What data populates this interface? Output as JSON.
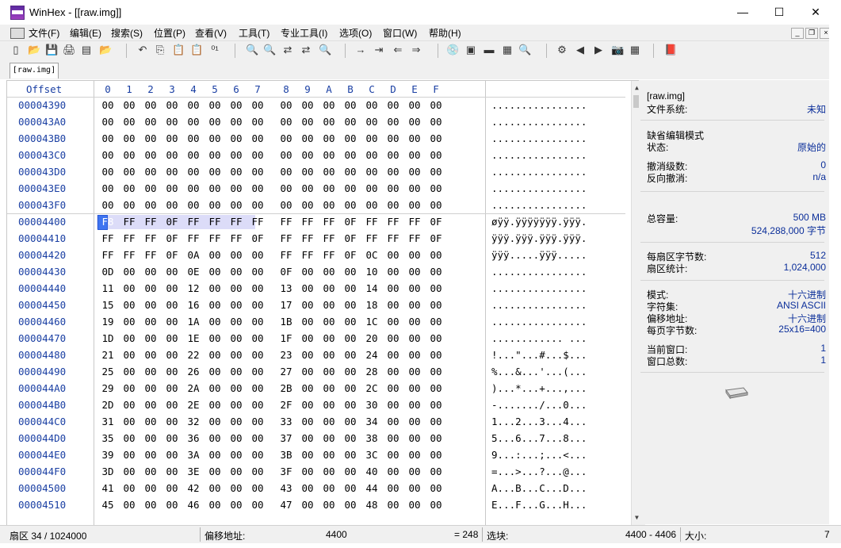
{
  "window": {
    "title": "WinHex - [[raw.img]]",
    "minimize": "—",
    "maximize": "☐",
    "close": "✕"
  },
  "menu": {
    "items": [
      "文件(F)",
      "编辑(E)",
      "搜索(S)",
      "位置(P)",
      "查看(V)",
      "工具(T)",
      "专业工具(I)",
      "选项(O)",
      "窗口(W)",
      "帮助(H)"
    ]
  },
  "mdi": {
    "min": "_",
    "restore": "❐",
    "close": "×"
  },
  "toolbar": {
    "icons": [
      "new-file-icon",
      "open-folder-icon",
      "save-icon",
      "print-icon",
      "properties-icon",
      "open-folder-2-icon",
      "undo-icon",
      "copy-icon",
      "paste-icon",
      "clipboard-icon",
      "hex-write-icon",
      "find-icon",
      "find-hex-icon",
      "replace-icon",
      "replace-hex-icon",
      "find-next-icon",
      "goto-offset-icon",
      "goto-sector-icon",
      "back-icon",
      "forward-icon",
      "disk-open-icon",
      "disk-clone-icon",
      "ram-icon",
      "calculator-icon",
      "magnifier-icon",
      "analyze-icon",
      "prev-icon",
      "next-icon",
      "snapshot-icon",
      "table-icon",
      "book-icon"
    ],
    "glyphs": [
      "▯",
      "📂",
      "💾",
      "🖨",
      "▤",
      "📂",
      "↶",
      "⎘",
      "📋",
      "📋",
      "⁰¹",
      "🔍",
      "🔍",
      "⇄",
      "⇄",
      "🔍",
      "→",
      "⇥",
      "⇐",
      "⇒",
      "💿",
      "▣",
      "▬",
      "▦",
      "🔍",
      "⚙",
      "◀",
      "▶",
      "📷",
      "▦",
      "📕"
    ]
  },
  "tab": {
    "label": "[raw.img]"
  },
  "editor": {
    "offset_header": "Offset",
    "columns": [
      "0",
      "1",
      "2",
      "3",
      "4",
      "5",
      "6",
      "7",
      "8",
      "9",
      "A",
      "B",
      "C",
      "D",
      "E",
      "F"
    ],
    "rows_top": [
      {
        "offset": "00004390",
        "bytes": [
          "00",
          "00",
          "00",
          "00",
          "00",
          "00",
          "00",
          "00",
          "00",
          "00",
          "00",
          "00",
          "00",
          "00",
          "00",
          "00"
        ],
        "ascii": "................"
      },
      {
        "offset": "000043A0",
        "bytes": [
          "00",
          "00",
          "00",
          "00",
          "00",
          "00",
          "00",
          "00",
          "00",
          "00",
          "00",
          "00",
          "00",
          "00",
          "00",
          "00"
        ],
        "ascii": "................"
      },
      {
        "offset": "000043B0",
        "bytes": [
          "00",
          "00",
          "00",
          "00",
          "00",
          "00",
          "00",
          "00",
          "00",
          "00",
          "00",
          "00",
          "00",
          "00",
          "00",
          "00"
        ],
        "ascii": "................"
      },
      {
        "offset": "000043C0",
        "bytes": [
          "00",
          "00",
          "00",
          "00",
          "00",
          "00",
          "00",
          "00",
          "00",
          "00",
          "00",
          "00",
          "00",
          "00",
          "00",
          "00"
        ],
        "ascii": "................"
      },
      {
        "offset": "000043D0",
        "bytes": [
          "00",
          "00",
          "00",
          "00",
          "00",
          "00",
          "00",
          "00",
          "00",
          "00",
          "00",
          "00",
          "00",
          "00",
          "00",
          "00"
        ],
        "ascii": "................"
      },
      {
        "offset": "000043E0",
        "bytes": [
          "00",
          "00",
          "00",
          "00",
          "00",
          "00",
          "00",
          "00",
          "00",
          "00",
          "00",
          "00",
          "00",
          "00",
          "00",
          "00"
        ],
        "ascii": "................"
      },
      {
        "offset": "000043F0",
        "bytes": [
          "00",
          "00",
          "00",
          "00",
          "00",
          "00",
          "00",
          "00",
          "00",
          "00",
          "00",
          "00",
          "00",
          "00",
          "00",
          "00"
        ],
        "ascii": "................"
      }
    ],
    "rows_bottom": [
      {
        "offset": "00004400",
        "bytes": [
          "F8",
          "FF",
          "FF",
          "0F",
          "FF",
          "FF",
          "FF",
          "FF",
          "FF",
          "FF",
          "FF",
          "0F",
          "FF",
          "FF",
          "FF",
          "0F"
        ],
        "ascii": "øÿÿ.ÿÿÿÿÿÿÿ.ÿÿÿ."
      },
      {
        "offset": "00004410",
        "bytes": [
          "FF",
          "FF",
          "FF",
          "0F",
          "FF",
          "FF",
          "FF",
          "0F",
          "FF",
          "FF",
          "FF",
          "0F",
          "FF",
          "FF",
          "FF",
          "0F"
        ],
        "ascii": "ÿÿÿ.ÿÿÿ.ÿÿÿ.ÿÿÿ."
      },
      {
        "offset": "00004420",
        "bytes": [
          "FF",
          "FF",
          "FF",
          "0F",
          "0A",
          "00",
          "00",
          "00",
          "FF",
          "FF",
          "FF",
          "0F",
          "0C",
          "00",
          "00",
          "00"
        ],
        "ascii": "ÿÿÿ.....ÿÿÿ....."
      },
      {
        "offset": "00004430",
        "bytes": [
          "0D",
          "00",
          "00",
          "00",
          "0E",
          "00",
          "00",
          "00",
          "0F",
          "00",
          "00",
          "00",
          "10",
          "00",
          "00",
          "00"
        ],
        "ascii": "................"
      },
      {
        "offset": "00004440",
        "bytes": [
          "11",
          "00",
          "00",
          "00",
          "12",
          "00",
          "00",
          "00",
          "13",
          "00",
          "00",
          "00",
          "14",
          "00",
          "00",
          "00"
        ],
        "ascii": "................"
      },
      {
        "offset": "00004450",
        "bytes": [
          "15",
          "00",
          "00",
          "00",
          "16",
          "00",
          "00",
          "00",
          "17",
          "00",
          "00",
          "00",
          "18",
          "00",
          "00",
          "00"
        ],
        "ascii": "................"
      },
      {
        "offset": "00004460",
        "bytes": [
          "19",
          "00",
          "00",
          "00",
          "1A",
          "00",
          "00",
          "00",
          "1B",
          "00",
          "00",
          "00",
          "1C",
          "00",
          "00",
          "00"
        ],
        "ascii": "................"
      },
      {
        "offset": "00004470",
        "bytes": [
          "1D",
          "00",
          "00",
          "00",
          "1E",
          "00",
          "00",
          "00",
          "1F",
          "00",
          "00",
          "00",
          "20",
          "00",
          "00",
          "00"
        ],
        "ascii": "............ ..."
      },
      {
        "offset": "00004480",
        "bytes": [
          "21",
          "00",
          "00",
          "00",
          "22",
          "00",
          "00",
          "00",
          "23",
          "00",
          "00",
          "00",
          "24",
          "00",
          "00",
          "00"
        ],
        "ascii": "!...\"...#...$..."
      },
      {
        "offset": "00004490",
        "bytes": [
          "25",
          "00",
          "00",
          "00",
          "26",
          "00",
          "00",
          "00",
          "27",
          "00",
          "00",
          "00",
          "28",
          "00",
          "00",
          "00"
        ],
        "ascii": "%...&...'...(..."
      },
      {
        "offset": "000044A0",
        "bytes": [
          "29",
          "00",
          "00",
          "00",
          "2A",
          "00",
          "00",
          "00",
          "2B",
          "00",
          "00",
          "00",
          "2C",
          "00",
          "00",
          "00"
        ],
        "ascii": ")...*...+...,..."
      },
      {
        "offset": "000044B0",
        "bytes": [
          "2D",
          "00",
          "00",
          "00",
          "2E",
          "00",
          "00",
          "00",
          "2F",
          "00",
          "00",
          "00",
          "30",
          "00",
          "00",
          "00"
        ],
        "ascii": "-......./...0..."
      },
      {
        "offset": "000044C0",
        "bytes": [
          "31",
          "00",
          "00",
          "00",
          "32",
          "00",
          "00",
          "00",
          "33",
          "00",
          "00",
          "00",
          "34",
          "00",
          "00",
          "00"
        ],
        "ascii": "1...2...3...4..."
      },
      {
        "offset": "000044D0",
        "bytes": [
          "35",
          "00",
          "00",
          "00",
          "36",
          "00",
          "00",
          "00",
          "37",
          "00",
          "00",
          "00",
          "38",
          "00",
          "00",
          "00"
        ],
        "ascii": "5...6...7...8..."
      },
      {
        "offset": "000044E0",
        "bytes": [
          "39",
          "00",
          "00",
          "00",
          "3A",
          "00",
          "00",
          "00",
          "3B",
          "00",
          "00",
          "00",
          "3C",
          "00",
          "00",
          "00"
        ],
        "ascii": "9...:...;...<..."
      },
      {
        "offset": "000044F0",
        "bytes": [
          "3D",
          "00",
          "00",
          "00",
          "3E",
          "00",
          "00",
          "00",
          "3F",
          "00",
          "00",
          "00",
          "40",
          "00",
          "00",
          "00"
        ],
        "ascii": "=...>...?...@..."
      },
      {
        "offset": "00004500",
        "bytes": [
          "41",
          "00",
          "00",
          "00",
          "42",
          "00",
          "00",
          "00",
          "43",
          "00",
          "00",
          "00",
          "44",
          "00",
          "00",
          "00"
        ],
        "ascii": "A...B...C...D..."
      },
      {
        "offset": "00004510",
        "bytes": [
          "45",
          "00",
          "00",
          "00",
          "46",
          "00",
          "00",
          "00",
          "47",
          "00",
          "00",
          "00",
          "48",
          "00",
          "00",
          "00"
        ],
        "ascii": "E...F...G...H..."
      }
    ]
  },
  "info": {
    "file_name": "[raw.img]",
    "filesystem_label": "文件系统:",
    "filesystem_value": "未知",
    "edit_mode_heading": "缺省编辑模式",
    "state_label": "状态:",
    "state_value": "原始的",
    "undo_level_label": "撤消级数:",
    "undo_level_value": "0",
    "reverse_undo_label": "反向撤消:",
    "reverse_undo_value": "n/a",
    "capacity_label": "总容量:",
    "capacity_value": "500 MB",
    "capacity_bytes": "524,288,000 字节",
    "bytes_per_sector_label": "每扇区字节数:",
    "bytes_per_sector_value": "512",
    "sector_count_label": "扇区统计:",
    "sector_count_value": "1,024,000",
    "mode_label": "模式:",
    "mode_value": "十六进制",
    "charset_label": "字符集:",
    "charset_value": "ANSI ASCII",
    "offset_mode_label": "偏移地址:",
    "offset_mode_value": "十六进制",
    "bytes_per_page_label": "每页字节数:",
    "bytes_per_page_value": "25x16=400",
    "current_window_label": "当前窗口:",
    "current_window_value": "1",
    "window_total_label": "窗口总数:",
    "window_total_value": "1"
  },
  "status": {
    "sector": "扇区 34 / 1024000",
    "offset_label": "偏移地址:",
    "offset_value": "4400",
    "eq_value": "= 248",
    "selection_label": "选块:",
    "selection_value": "4400 - 4406",
    "size_label": "大小:",
    "size_value": "7"
  }
}
